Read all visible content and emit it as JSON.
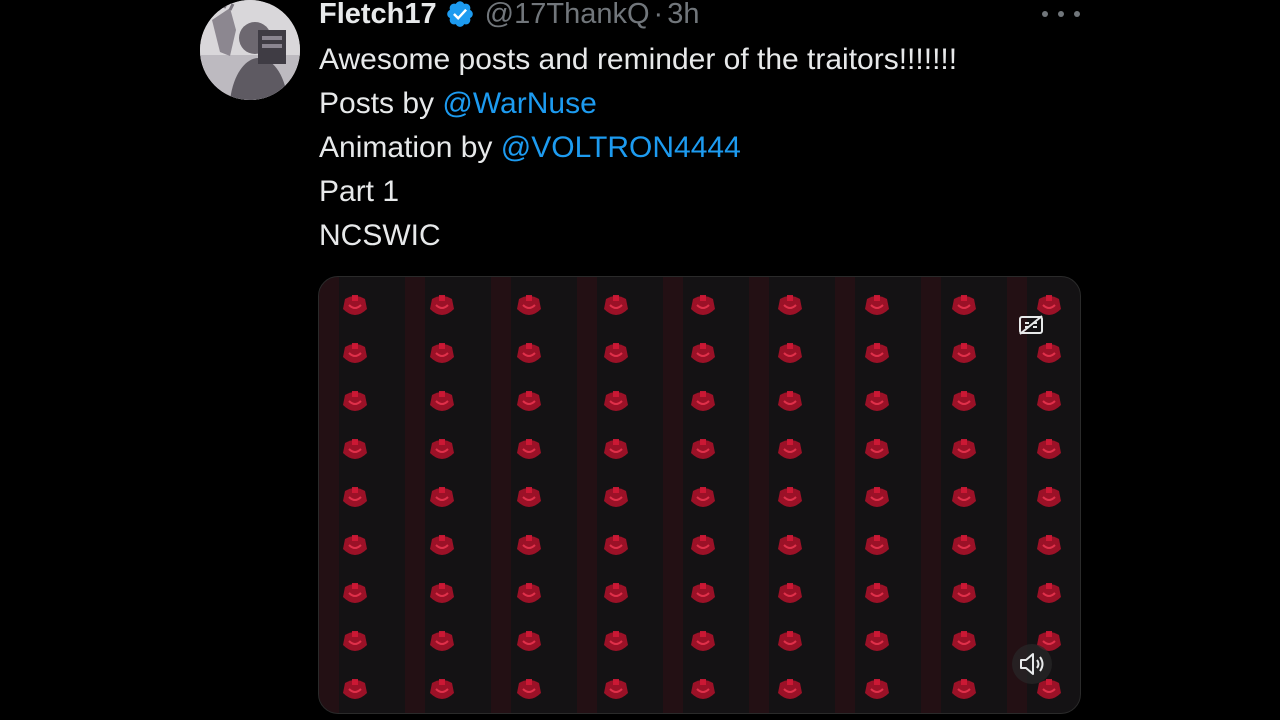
{
  "tweet": {
    "author": {
      "display_name": "Fletch17",
      "handle": "@17ThankQ",
      "verified": true,
      "avatar_icon": "avatar-photo"
    },
    "separator": "·",
    "time": "3h",
    "more_icon": "more-horizontal-icon",
    "text_lines": [
      {
        "prefix": "Awesome posts and reminder of the traitors!!!!!!!",
        "mention": ""
      },
      {
        "prefix": "Posts by ",
        "mention": "@WarNuse"
      },
      {
        "prefix": "Animation by ",
        "mention": "@VOLTRON4444"
      },
      {
        "prefix": "Part 1",
        "mention": ""
      },
      {
        "prefix": "NCSWIC",
        "mention": ""
      }
    ],
    "media": {
      "type": "video",
      "captions_icon": "captions-off-icon",
      "volume_icon": "volume-icon"
    }
  },
  "colors": {
    "background": "#000000",
    "text": "#e7e9ea",
    "muted": "#71767b",
    "link": "#1d9bf0",
    "verified": "#1d9bf0",
    "media_pattern": "#c0142c"
  }
}
